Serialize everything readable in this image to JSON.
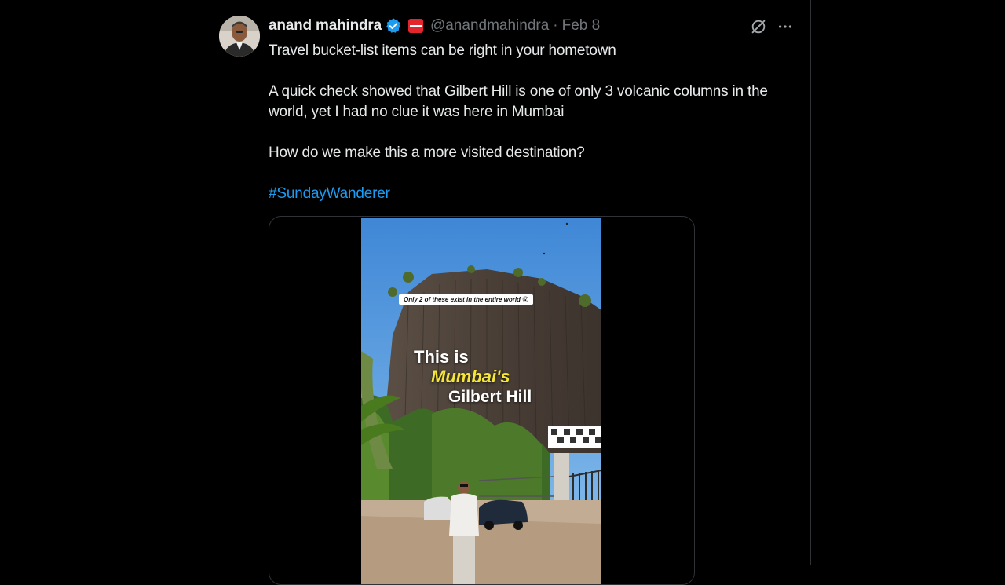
{
  "author": {
    "name": "anand mahindra",
    "handle": "@anandmahindra",
    "separator": "·",
    "date": "Feb 8"
  },
  "icons": {
    "verified": "verified-badge-icon",
    "affiliate": "affiliate-logo-icon",
    "grok": "grok-icon",
    "more": "more-options-icon"
  },
  "colors": {
    "background": "#000000",
    "text": "#e7e9ea",
    "secondary": "#71767b",
    "link": "#1d9bf0",
    "verified": "#1d9bf0",
    "affiliate": "#e3262e"
  },
  "tweet": {
    "line1": "Travel bucket-list items can be right in your hometown",
    "line2": "A quick check showed that Gilbert Hill is one of only 3 volcanic columns in the world, yet I had no clue it was here in Mumbai",
    "line3": "How do we make this a more visited destination?",
    "hashtag": "#SundayWanderer"
  },
  "media": {
    "caption": "Only 2 of these exist in the entire world 😮",
    "overlay_line1": "This is",
    "overlay_line2": "Mumbai's",
    "overlay_line3": "Gilbert Hill"
  }
}
